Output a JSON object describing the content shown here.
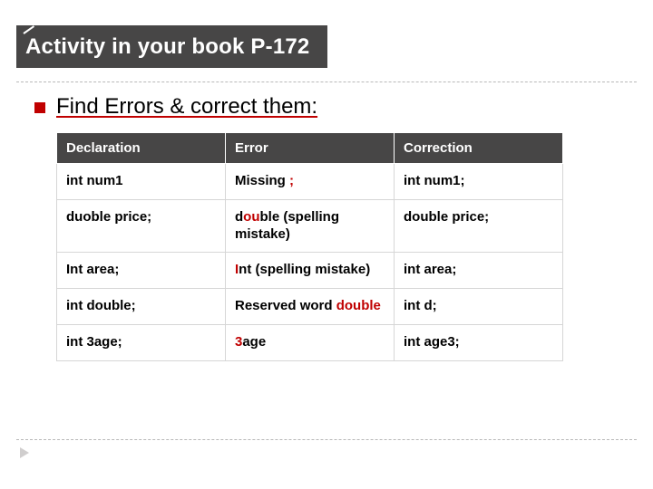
{
  "title": "Activity in your book P-172",
  "bullet": "Find Errors & correct them:",
  "table": {
    "headers": [
      "Declaration",
      "Error",
      "Correction"
    ],
    "rows": [
      {
        "declaration": [
          {
            "t": "int num1"
          }
        ],
        "error": [
          {
            "t": "Missing "
          },
          {
            "t": ";",
            "hl": true
          }
        ],
        "correction": [
          {
            "t": "int num1;"
          }
        ]
      },
      {
        "declaration": [
          {
            "t": "duoble price;"
          }
        ],
        "error": [
          {
            "t": "d"
          },
          {
            "t": "ou",
            "hl": true
          },
          {
            "t": "ble (spelling mistake)"
          }
        ],
        "correction": [
          {
            "t": "double price;"
          }
        ]
      },
      {
        "declaration": [
          {
            "t": "Int area;"
          }
        ],
        "error": [
          {
            "t": "I",
            "hl": true
          },
          {
            "t": "nt (spelling mistake)"
          }
        ],
        "correction": [
          {
            "t": "int area;"
          }
        ]
      },
      {
        "declaration": [
          {
            "t": "int double;"
          }
        ],
        "error": [
          {
            "t": "Reserved word "
          },
          {
            "t": "double",
            "hl": true
          }
        ],
        "correction": [
          {
            "t": "int d;"
          }
        ]
      },
      {
        "declaration": [
          {
            "t": "int 3age;"
          }
        ],
        "error": [
          {
            "t": "3",
            "hl": true
          },
          {
            "t": "age"
          }
        ],
        "correction": [
          {
            "t": "int age3;"
          }
        ]
      }
    ]
  }
}
